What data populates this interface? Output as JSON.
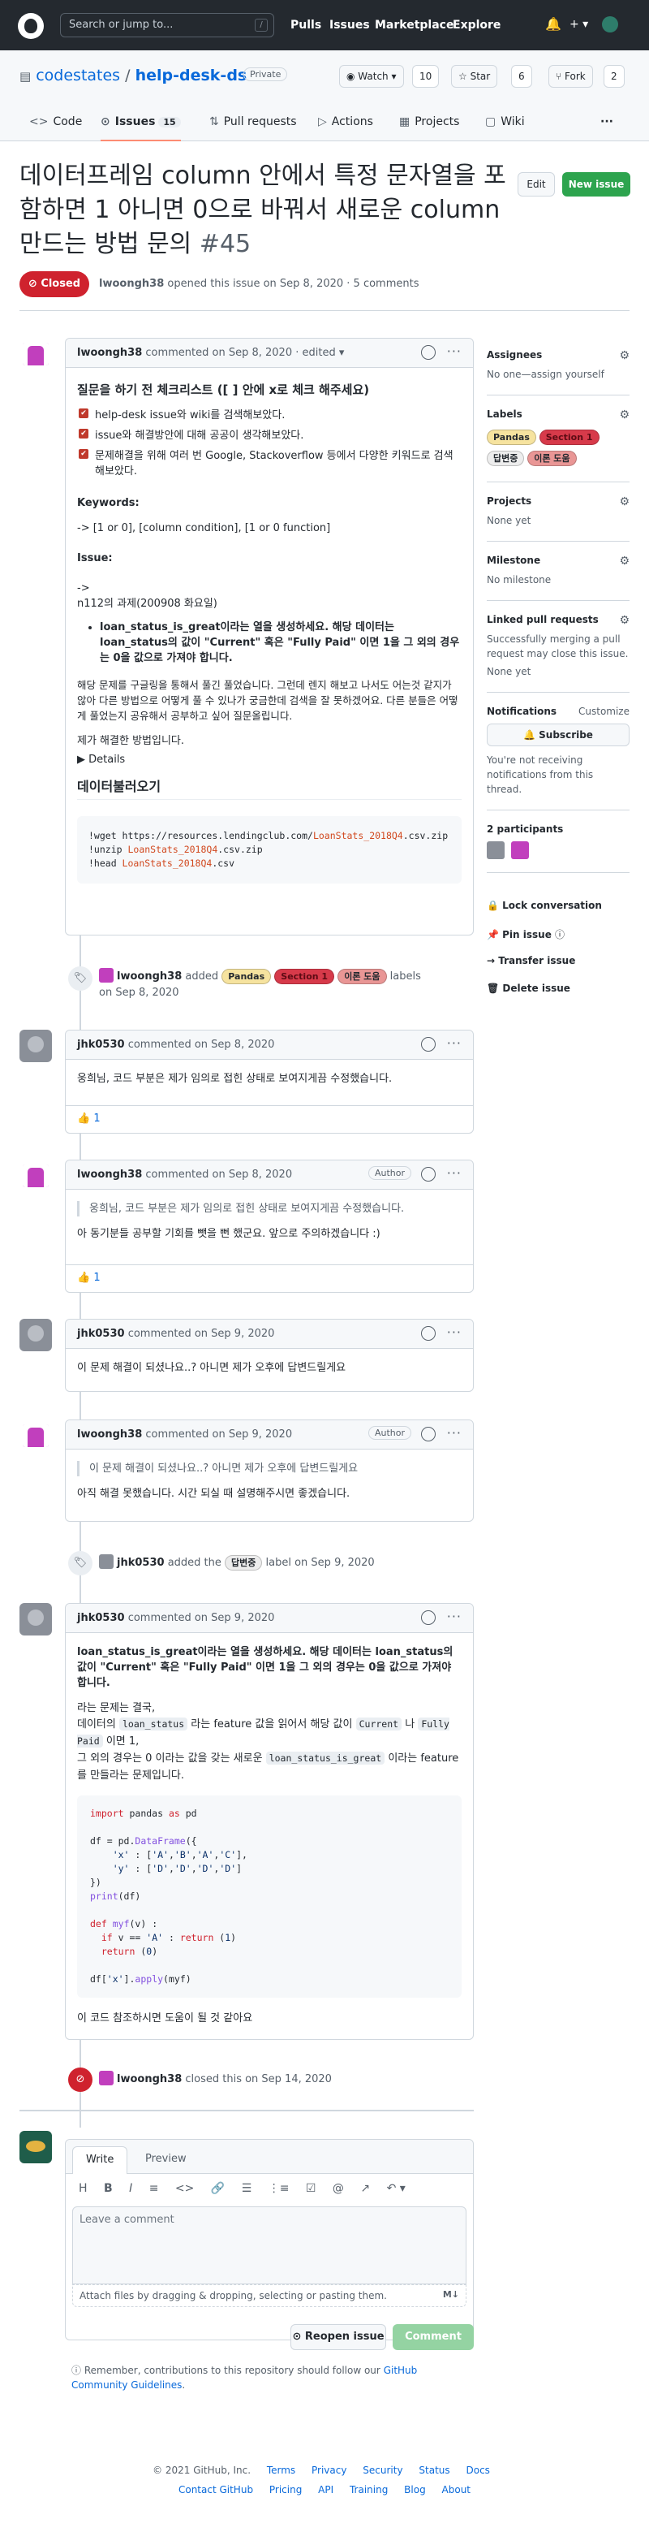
{
  "header": {
    "search_placeholder": "Search or jump to...",
    "slash": "/",
    "nav": [
      "Pulls",
      "Issues",
      "Marketplace",
      "Explore"
    ],
    "bell_icon": "bell-icon",
    "plus_icon": "+ ▾"
  },
  "repo": {
    "owner": "codestates",
    "sep": "/",
    "name": "help-desk-ds",
    "visibility": "Private",
    "watch_label": "Watch ▾",
    "watch_count": "10",
    "star_label": "☆ Star",
    "star_count": "6",
    "fork_label": "Fork",
    "fork_count": "2"
  },
  "tabs": [
    {
      "label": "Code",
      "icon": "<>"
    },
    {
      "label": "Issues",
      "icon": "⊙",
      "count": "15"
    },
    {
      "label": "Pull requests",
      "icon": "⇅"
    },
    {
      "label": "Actions",
      "icon": "▷"
    },
    {
      "label": "Projects",
      "icon": "▦"
    },
    {
      "label": "Wiki",
      "icon": "▢"
    },
    {
      "label": "···"
    }
  ],
  "issue": {
    "title": "데이터프레임 column 안에서 특정 문자열을 포함하면 1 아니면 0으로 바꿔서 새로운 column 만드는 방법 문의",
    "number": "#45",
    "edit_label": "Edit",
    "new_label": "New issue",
    "state": "Closed",
    "author": "lwoongh38",
    "meta_rest": "opened this issue on Sep 8, 2020 · 5 comments"
  },
  "first_comment": {
    "author": "lwoongh38",
    "meta": "commented on Sep 8, 2020 · edited ▾",
    "heading": "질문을 하기 전 체크리스트 ([ ] 안에 x로 체크 해주세요)",
    "checklist": [
      "help-desk issue와 wiki를 검색해보았다.",
      "issue와 해결방안에 대해 공공이 생각해보았다.",
      "문제해결을 위해 여러 번 Google, Stackoverflow 등에서 다양한 키워드로 검색해보았다."
    ],
    "keywords_label": "Keywords:",
    "keywords": "-> [1 or 0], [column condition], [1 or 0 function]",
    "issue_label": "Issue:",
    "arrow": "->",
    "date_line": "n112의 과제(200908 화요일)",
    "bullet": "loan_status_is_great이라는 열을 생성하세요. 해당 데이터는 loan_status의 값이 \"Current\" 혹은 \"Fully Paid\" 이면 1을 그 외의 경우는 0을 값으로 가져야 합니다.",
    "para": "해당 문제를 구글링을 통해서 풀긴 풀었습니다. 그런데 렌지 해보고 나서도 어는것 같지가 않아 다른 방법으로 어떻게 풀 수 있나가 궁금한데 검색을 잘 못하겠어요. 다른 분들은 어떻게 풀었는지 공유해서 공부하고 싶어 질문올립니다.",
    "solved": "제가 해결한 방법입니다.",
    "details": "▶  Details",
    "data_heading": "데이터불러오기",
    "code_lines": [
      {
        "pre": "!wget https://resources.lendingclub.com/",
        "hl": "LoanStats_2018Q4",
        "post": ".csv.zip"
      },
      {
        "pre": "!unzip ",
        "hl": "LoanStats_2018Q4",
        "post": ".csv.zip"
      },
      {
        "pre": "!head ",
        "hl": "LoanStats_2018Q4",
        "post": ".csv"
      }
    ]
  },
  "event_labels": {
    "author": "lwoongh38",
    "action": "added",
    "labels": [
      {
        "text": "Pandas",
        "color": "#f9d0c4"
      },
      {
        "text": "Section 1",
        "color": "#d73a4a"
      },
      {
        "text": "이론 도움",
        "color": "#e99695"
      }
    ],
    "suffix": "labels",
    "date": "on Sep 8, 2020"
  },
  "comment2": {
    "author": "jhk0530",
    "meta": "commented on Sep 8, 2020",
    "text": "웅희님, 코드 부분은 제가 임의로 접힌 상태로 보여지게끔 수정했습니다.",
    "reaction": "👍 1"
  },
  "comment3": {
    "author": "lwoongh38",
    "meta": "commented on Sep 8, 2020",
    "role": "Author",
    "quote": "웅희님, 코드 부분은 제가 임의로 접힌 상태로 보여지게끔 수정했습니다.",
    "text": "아 동기분들 공부할 기회를 뺏을 뻔 했군요. 앞으로 주의하겠습니다 :)",
    "reaction": "👍 1"
  },
  "comment4": {
    "author": "jhk0530",
    "meta": "commented on Sep 9, 2020",
    "text": "이 문제 해결이 되셨나요..? 아니면 제가 오후에 답변드릴게요"
  },
  "comment5": {
    "author": "lwoongh38",
    "meta": "commented on Sep 9, 2020",
    "role": "Author",
    "quote": "이 문제 해결이 되셨나요..? 아니면 제가 오후에 답변드릴게요",
    "text": "아직 해결 못했습니다. 시간 되실 때 설명해주시면 좋겠습니다."
  },
  "event_label2": {
    "author": "jhk0530",
    "action": "added the",
    "label": "답변중",
    "suffix": "label on Sep 9, 2020"
  },
  "comment6": {
    "author": "jhk0530",
    "meta": "commented on Sep 9, 2020",
    "bold": "loan_status_is_great이라는 열을 생성하세요. 해당 데이터는 loan_status의 값이 \"Current\" 혹은 \"Fully Paid\" 이면 1을 그 외의 경우는 0을 값으로 가져야 합니다.",
    "l1": "라는 문제는 결국,",
    "l2a": "데이터의",
    "l2code": "loan_status",
    "l2b": "라는 feature 값을 읽어서 해당 값이",
    "l2c1": "Current",
    "l2c": "나",
    "l2c2": "Fully Paid",
    "l2d": "이면 1,",
    "l3a": "그 외의 경우는 0 이라는 값을 갖는 새로운",
    "l3code": "loan_status_is_great",
    "l3b": "이라는 feature 를 만들라는 문제입니다.",
    "end": "이 코드 참조하시면 도움이 될 것 같아요"
  },
  "closed_event": {
    "author": "lwoongh38",
    "text": "closed this on Sep 14, 2020"
  },
  "editor": {
    "tab_write": "Write",
    "tab_preview": "Preview",
    "tools": [
      "H",
      "B",
      "I",
      "≡",
      "<>",
      "🔗",
      "☰",
      "⋮≡",
      "☑",
      "@",
      "↗",
      "↶ ▾"
    ],
    "placeholder": "Leave a comment",
    "attach": "Attach files by dragging & dropping, selecting or pasting them.",
    "md_icon": "M↓",
    "reopen": "Reopen issue",
    "comment": "Comment"
  },
  "remember": {
    "text": "Remember, contributions to this repository should follow our",
    "link": "GitHub Community Guidelines",
    "dot": "."
  },
  "sidebar": {
    "assignees_title": "Assignees",
    "assignees_value": "No one—assign yourself",
    "labels_title": "Labels",
    "labels": [
      {
        "text": "Pandas",
        "color": "#f9d0c4"
      },
      {
        "text": "Section 1",
        "color": "#d73a4a"
      },
      {
        "text": "답변중",
        "color": "#ededed"
      },
      {
        "text": "이론 도움",
        "color": "#e99695"
      }
    ],
    "projects_title": "Projects",
    "projects_value": "None yet",
    "milestone_title": "Milestone",
    "milestone_value": "No milestone",
    "linked_title": "Linked pull requests",
    "linked_value": "Successfully merging a pull request may close this issue.",
    "linked_value2": "None yet",
    "notif_title": "Notifications",
    "notif_customize": "Customize",
    "subscribe": "Subscribe",
    "notif_text": "You're not receiving notifications from this thread.",
    "participants": "2 participants",
    "lock": "Lock conversation",
    "pin": "Pin issue",
    "transfer": "Transfer issue",
    "delete": "Delete issue"
  },
  "footer": {
    "copyright": "© 2021 GitHub, Inc.",
    "row1": [
      "Terms",
      "Privacy",
      "Security",
      "Status",
      "Docs"
    ],
    "row2": [
      "Contact GitHub",
      "Pricing",
      "API",
      "Training",
      "Blog",
      "About"
    ]
  }
}
